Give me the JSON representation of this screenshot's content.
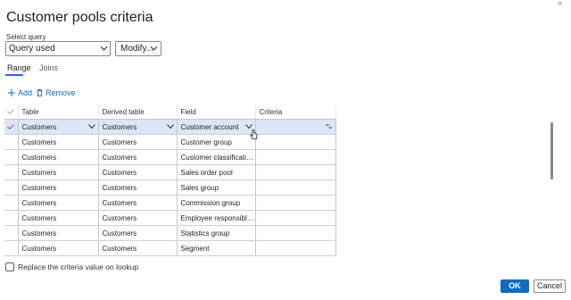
{
  "dialog": {
    "title": "Customer pools criteria"
  },
  "query": {
    "label": "Select query",
    "value": "Query used",
    "modify_label": "Modify..."
  },
  "tabs": [
    {
      "label": "Range",
      "active": true
    },
    {
      "label": "Joins",
      "active": false
    }
  ],
  "actions": {
    "add": "Add",
    "remove": "Remove"
  },
  "grid": {
    "columns": [
      "Table",
      "Derived table",
      "Field",
      "Criteria"
    ],
    "rows": [
      {
        "table": "Customers",
        "derived": "Customers",
        "field": "Customer account",
        "criteria": "",
        "selected": true
      },
      {
        "table": "Customers",
        "derived": "Customers",
        "field": "Customer group",
        "criteria": ""
      },
      {
        "table": "Customers",
        "derived": "Customers",
        "field": "Customer classification...",
        "criteria": ""
      },
      {
        "table": "Customers",
        "derived": "Customers",
        "field": "Sales order pool",
        "criteria": ""
      },
      {
        "table": "Customers",
        "derived": "Customers",
        "field": "Sales group",
        "criteria": ""
      },
      {
        "table": "Customers",
        "derived": "Customers",
        "field": "Commission group",
        "criteria": ""
      },
      {
        "table": "Customers",
        "derived": "Customers",
        "field": "Employee responsible ...",
        "criteria": ""
      },
      {
        "table": "Customers",
        "derived": "Customers",
        "field": "Statistics group",
        "criteria": ""
      },
      {
        "table": "Customers",
        "derived": "Customers",
        "field": "Segment",
        "criteria": ""
      }
    ]
  },
  "lookup_option": {
    "label": "Replace the criteria value on lookup",
    "checked": false
  },
  "buttons": {
    "ok": "OK",
    "cancel": "Cancel"
  },
  "colors": {
    "accent": "#0f6cbd",
    "selected_row": "#dde5f6"
  },
  "icons": {
    "add": "plus-icon",
    "remove": "trash-icon",
    "dropdown": "chevron-down-icon",
    "row_select": "checkmark-icon"
  }
}
